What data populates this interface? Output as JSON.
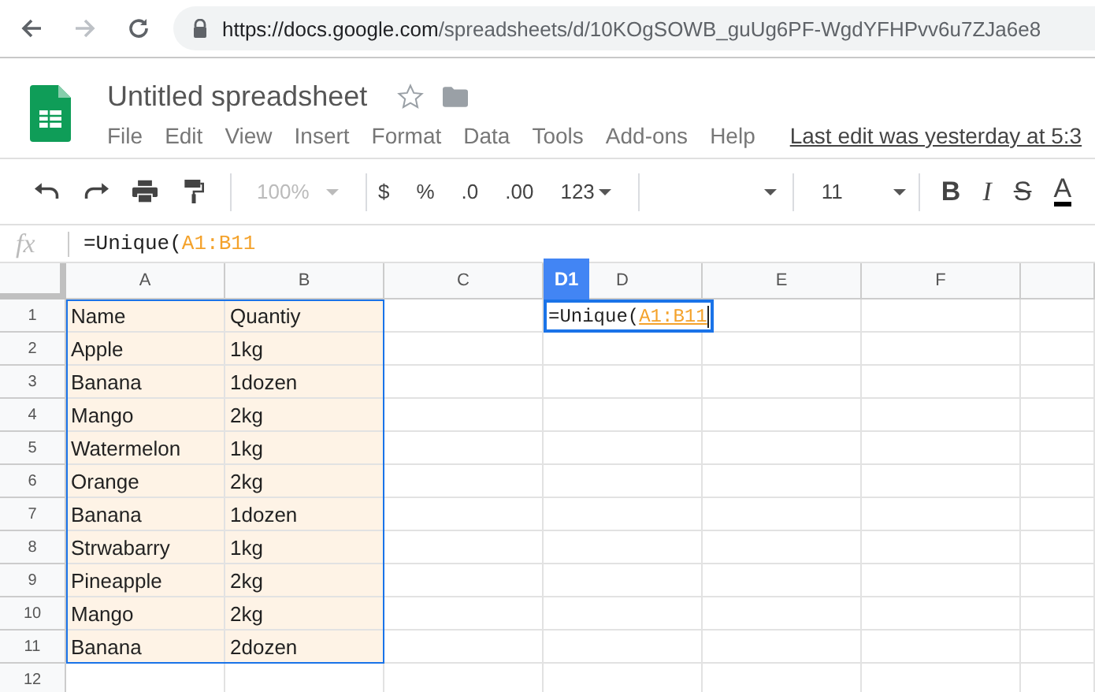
{
  "browser": {
    "url_host": "https://docs.google.com",
    "url_path": "/spreadsheets/d/10KOgSOWB_guUg6PF-WgdYFHPvv6u7ZJa6e8"
  },
  "document": {
    "title": "Untitled spreadsheet",
    "menu": [
      "File",
      "Edit",
      "View",
      "Insert",
      "Format",
      "Data",
      "Tools",
      "Add-ons",
      "Help"
    ],
    "last_edit": "Last edit was yesterday at 5:3"
  },
  "toolbar": {
    "zoom": "100%",
    "currency": "$",
    "percent": "%",
    "decrease_decimals": ".0",
    "increase_decimals": ".00",
    "number_format": "123",
    "font_size": "11",
    "bold": "B",
    "italic": "I",
    "strikethrough": "S",
    "text_color": "A"
  },
  "formula_bar": {
    "fx": "fx",
    "prefix": "=Unique(",
    "range": "A1:B11"
  },
  "grid": {
    "columns": [
      {
        "label": "A",
        "selected": false
      },
      {
        "label": "B",
        "selected": false
      },
      {
        "label": "C",
        "selected": false
      },
      {
        "label": "D",
        "selected": true
      },
      {
        "label": "E",
        "selected": false
      },
      {
        "label": "F",
        "selected": false
      }
    ],
    "active_cell": {
      "badge": "D1",
      "prefix": "=Unique(",
      "range": "A1:B11"
    },
    "rows": [
      {
        "number": "1",
        "cells": [
          "Name",
          "Quantiy"
        ],
        "in_copy_range": true
      },
      {
        "number": "2",
        "cells": [
          "Apple",
          "1kg"
        ],
        "in_copy_range": true
      },
      {
        "number": "3",
        "cells": [
          "Banana",
          "1dozen"
        ],
        "in_copy_range": true
      },
      {
        "number": "4",
        "cells": [
          "Mango",
          "2kg"
        ],
        "in_copy_range": true
      },
      {
        "number": "5",
        "cells": [
          "Watermelon",
          "1kg"
        ],
        "in_copy_range": true
      },
      {
        "number": "6",
        "cells": [
          "Orange",
          "2kg"
        ],
        "in_copy_range": true
      },
      {
        "number": "7",
        "cells": [
          "Banana",
          "1dozen"
        ],
        "in_copy_range": true
      },
      {
        "number": "8",
        "cells": [
          "Strwabarry",
          "1kg"
        ],
        "in_copy_range": true
      },
      {
        "number": "9",
        "cells": [
          "Pineapple",
          "2kg"
        ],
        "in_copy_range": true
      },
      {
        "number": "10",
        "cells": [
          "Mango",
          "2kg"
        ],
        "in_copy_range": true
      },
      {
        "number": "11",
        "cells": [
          "Banana",
          "2dozen"
        ],
        "in_copy_range": true
      },
      {
        "number": "12",
        "cells": [],
        "in_copy_range": false
      }
    ]
  }
}
